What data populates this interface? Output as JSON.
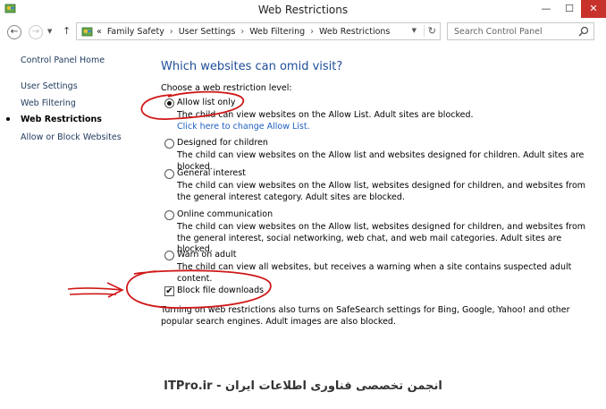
{
  "window": {
    "title": "Web Restrictions",
    "controls": {
      "minimize": "—",
      "maximize": "☐",
      "close": "✕"
    }
  },
  "nav": {
    "back": "←",
    "forward": "→",
    "dropdown": "▼",
    "up": "↑",
    "breadcrumb_prefix": "«",
    "breadcrumbs": [
      "Family Safety",
      "User Settings",
      "Web Filtering",
      "Web Restrictions"
    ],
    "separator": "›",
    "address_dropdown": "▼",
    "refresh": "↻",
    "search_placeholder": "Search Control Panel"
  },
  "sidebar": {
    "home": "Control Panel Home",
    "items": [
      {
        "label": "User Settings"
      },
      {
        "label": "Web Filtering"
      },
      {
        "label": "Web Restrictions"
      },
      {
        "label": "Allow or Block Websites"
      }
    ]
  },
  "main": {
    "heading": "Which websites can omid visit?",
    "prompt": "Choose a web restriction level:",
    "options": [
      {
        "label": "Allow list only",
        "desc": "The child can view websites on the Allow List. Adult sites are blocked.",
        "link": "Click here to change Allow List.",
        "selected": true
      },
      {
        "label": "Designed for children",
        "desc": "The child can view websites on the Allow list and websites designed for children. Adult sites are blocked.",
        "selected": false
      },
      {
        "label": "General interest",
        "desc": "The child can view websites on the Allow list, websites designed for children, and websites from the general interest category. Adult sites are blocked.",
        "selected": false
      },
      {
        "label": "Online communication",
        "desc": "The child can view websites on the Allow list, websites designed for children, and websites from the general interest, social networking, web chat, and web mail categories. Adult sites are blocked.",
        "selected": false
      },
      {
        "label": "Warn on adult",
        "desc": "The child can view all websites, but receives a warning when a site contains suspected adult content.",
        "selected": false
      }
    ],
    "block_downloads": {
      "label": "Block file downloads",
      "checked": true,
      "mark": "✔"
    },
    "note": "Turning on web restrictions also turns on SafeSearch settings for Bing, Google, Yahoo! and other popular search engines. Adult images are also blocked."
  },
  "watermark": "ITPro.ir - انجمن تخصصی فناوری اطلاعات ایران",
  "colors": {
    "heading": "#1e4e9a",
    "link": "#1f5fbf",
    "close_button": "#c7332b",
    "annotation": "#d01818"
  }
}
